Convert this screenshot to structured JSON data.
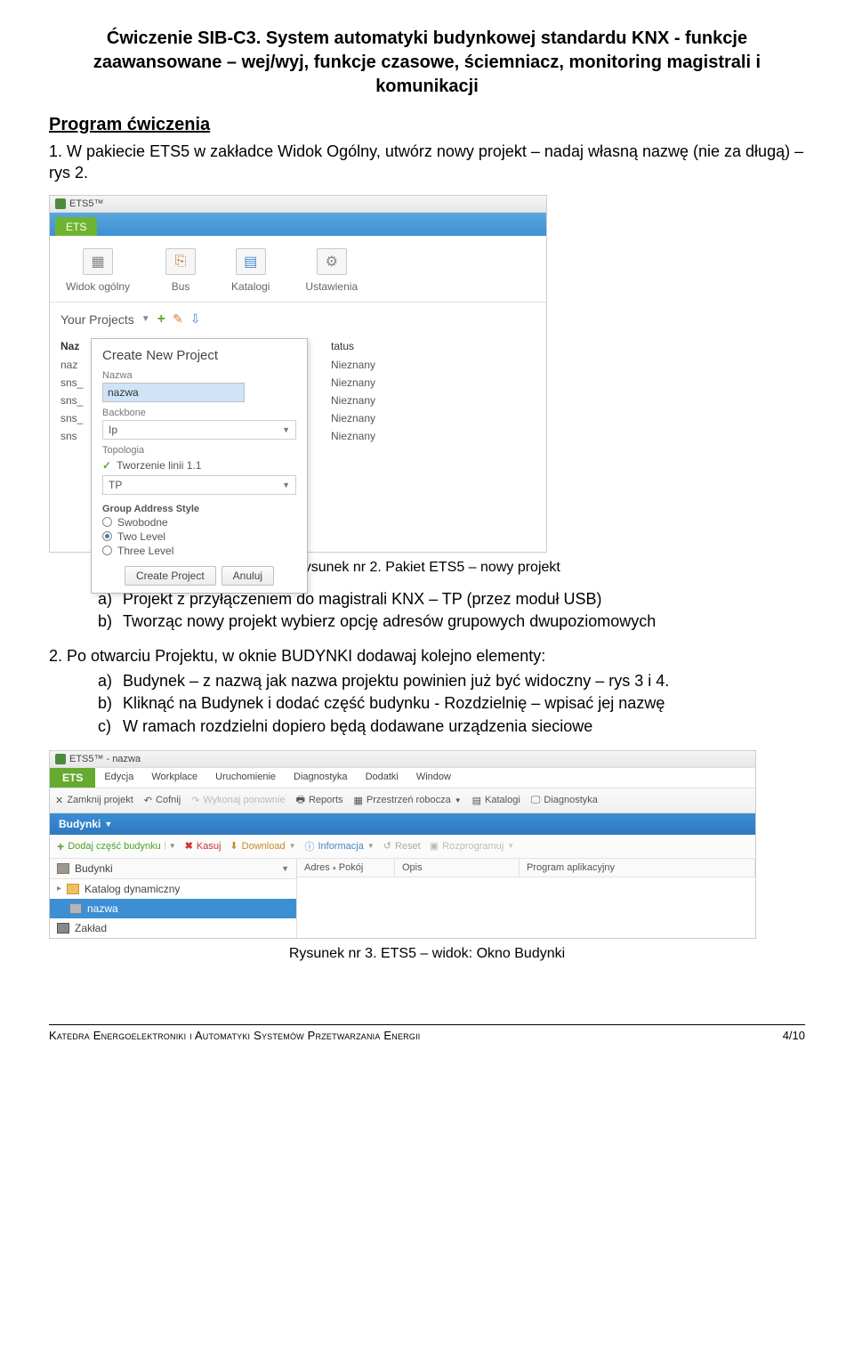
{
  "doc": {
    "title": "Ćwiczenie SIB-C3. System automatyki budynkowej standardu KNX - funkcje zaawansowane – wej/wyj, funkcje czasowe, ściemniacz, monitoring magistrali i komunikacji",
    "section": "Program ćwiczenia",
    "step1_num": "1.",
    "step1": "W pakiecie ETS5 w zakładce Widok Ogólny, utwórz nowy projekt – nadaj własną nazwę (nie za długą) – rys 2.",
    "fig2": "Rysunek nr 2. Pakiet ETS5 – nowy projekt",
    "sub_a": "Projekt z przyłączeniem do magistrali KNX – TP (przez moduł USB)",
    "sub_b": "Tworząc nowy projekt wybierz opcję adresów grupowych dwupoziomowych",
    "step2_num": "2.",
    "step2": "Po otwarciu Projektu, w oknie BUDYNKI dodawaj kolejno elementy:",
    "step2_a": "Budynek – z nazwą jak nazwa projektu powinien już być widoczny – rys 3 i 4.",
    "step2_b": "Kliknąć na Budynek i dodać część budynku - Rozdzielnię – wpisać jej nazwę",
    "step2_c": "W ramach rozdzielni dopiero będą dodawane urządzenia sieciowe",
    "fig3": "Rysunek nr 3. ETS5 – widok: Okno Budynki",
    "footer_left": "Katedra Energoelektroniki i Automatyki Systemów Przetwarzania Energii",
    "footer_right": "4/10"
  },
  "shot1": {
    "titlebar": "ETS5™",
    "tab": "ETS",
    "toolbar": [
      "Widok ogólny",
      "Bus",
      "Katalogi",
      "Ustawienia"
    ],
    "your_projects": "Your Projects",
    "table_head_left": "Naz",
    "table_head_right": "tatus",
    "rows_left": [
      "naz",
      "sns_",
      "sns_",
      "sns_",
      "sns"
    ],
    "rows_right": [
      "Nieznany",
      "Nieznany",
      "Nieznany",
      "Nieznany",
      "Nieznany"
    ],
    "popup": {
      "title": "Create New Project",
      "label_name": "Nazwa",
      "name_value": "nazwa",
      "label_backbone": "Backbone",
      "backbone_value": "Ip",
      "label_topology": "Topologia",
      "topology_check": "Tworzenie linii 1.1",
      "topology_select": "TP",
      "group_title": "Group Address Style",
      "radios": [
        "Swobodne",
        "Two Level",
        "Three Level"
      ],
      "radio_selected": 1,
      "btn_create": "Create Project",
      "btn_cancel": "Anuluj"
    }
  },
  "shot2": {
    "titlebar": "ETS5™ - nazwa",
    "ets_btn": "ETS",
    "menus": [
      "Edycja",
      "Workplace",
      "Uruchomienie",
      "Diagnostyka",
      "Dodatki",
      "Window"
    ],
    "toolbar": [
      "Zamknij projekt",
      "Cofnij",
      "Wykonaj ponownie",
      "Reports",
      "Przestrzeń robocza",
      "Katalogi",
      "Diagnostyka"
    ],
    "blue_label": "Budynki",
    "actions": {
      "add": "Dodaj część budynku",
      "del": "Kasuj",
      "download": "Download",
      "info": "Informacja",
      "reset": "Reset",
      "unprog": "Rozprogramuj"
    },
    "tree_head": "Budynki",
    "tree": {
      "dynamic": "Katalog dynamiczny",
      "project": "nazwa",
      "plant": "Zakład"
    },
    "cols": [
      "Adres",
      "Pokój",
      "Opis",
      "Program aplikacyjny"
    ]
  }
}
